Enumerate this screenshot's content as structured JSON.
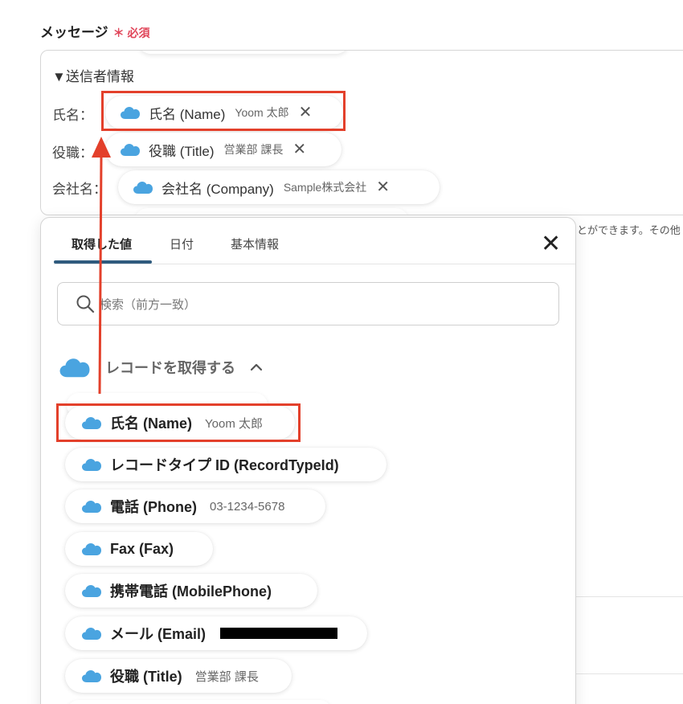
{
  "field": {
    "label": "メッセージ",
    "required": "＊ 必須"
  },
  "message": {
    "section_heading": "▼送信者情報",
    "rows": [
      {
        "label": "氏名：",
        "chip_label": "氏名 (Name)",
        "chip_value": "Yoom 太郎"
      },
      {
        "label": "役職：",
        "chip_label": "役職 (Title)",
        "chip_value": "営業部 課長"
      },
      {
        "label": "会社名：",
        "chip_label": "会社名 (Company)",
        "chip_value": "Sample株式会社"
      }
    ]
  },
  "helper_text": "とができます。その他",
  "popup": {
    "tabs": [
      "取得した値",
      "日付",
      "基本情報"
    ],
    "active_tab": "取得した値",
    "search": {
      "placeholder": "検索（前方一致）"
    },
    "group": {
      "title": "レコードを取得する",
      "expanded": true
    },
    "items": [
      {
        "label": "氏名 (Name)",
        "value": "Yoom 太郎"
      },
      {
        "label": "レコードタイプ ID (RecordTypeId)",
        "value": ""
      },
      {
        "label": "電話 (Phone)",
        "value": "03-1234-5678"
      },
      {
        "label": "Fax (Fax)",
        "value": ""
      },
      {
        "label": "携帯電話 (MobilePhone)",
        "value": ""
      },
      {
        "label": "メール (Email)",
        "value": "",
        "redacted": true
      },
      {
        "label": "役職 (Title)",
        "value": "営業部 課長"
      }
    ]
  },
  "colors": {
    "highlight": "#e3402b",
    "salesforce_cloud": "#4aa4e0",
    "required": "#e0465a",
    "tab_active": "#2f5b7e"
  },
  "icons": {
    "cloud": "salesforce-cloud-icon",
    "close": "close-icon",
    "search": "search-icon",
    "chevron": "chevron-up-icon"
  }
}
